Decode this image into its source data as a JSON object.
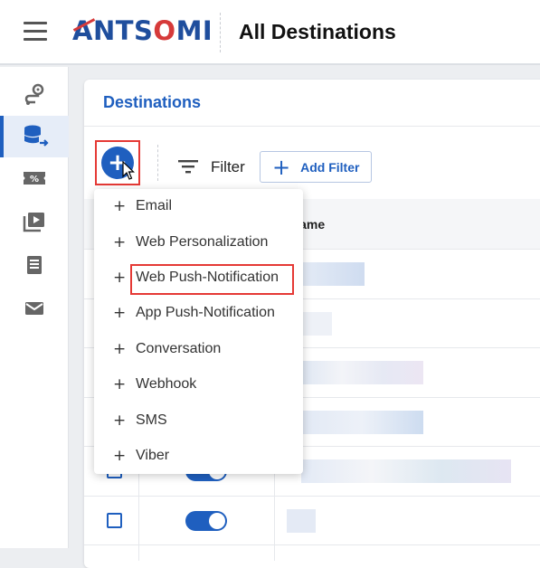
{
  "app": {
    "brand": "ANTSOMI",
    "page_title": "All Destinations"
  },
  "sidebar": {
    "items": [
      {
        "name": "journey",
        "icon": "route-pin-icon"
      },
      {
        "name": "destinations",
        "icon": "database-arrow-icon",
        "active": true
      },
      {
        "name": "promotions",
        "icon": "percent-ticket-icon"
      },
      {
        "name": "media",
        "icon": "media-play-icon"
      },
      {
        "name": "reports",
        "icon": "document-icon"
      },
      {
        "name": "email",
        "icon": "envelope-icon"
      }
    ]
  },
  "panel": {
    "title": "Destinations"
  },
  "toolbar": {
    "add_label": "+",
    "filter_label": "Filter",
    "add_filter_label": "Add Filter"
  },
  "table": {
    "name_header": "Name",
    "rows_visible": 6
  },
  "menu": {
    "items": [
      {
        "label": "Email"
      },
      {
        "label": "Web Personalization"
      },
      {
        "label": "Web Push-Notification",
        "highlighted": true
      },
      {
        "label": "App Push-Notification"
      },
      {
        "label": "Conversation"
      },
      {
        "label": "Webhook"
      },
      {
        "label": "SMS"
      },
      {
        "label": "Viber"
      }
    ]
  },
  "colors": {
    "primary": "#1f5fbf",
    "highlight": "#e53935",
    "brand_accent": "#d63a3a"
  }
}
